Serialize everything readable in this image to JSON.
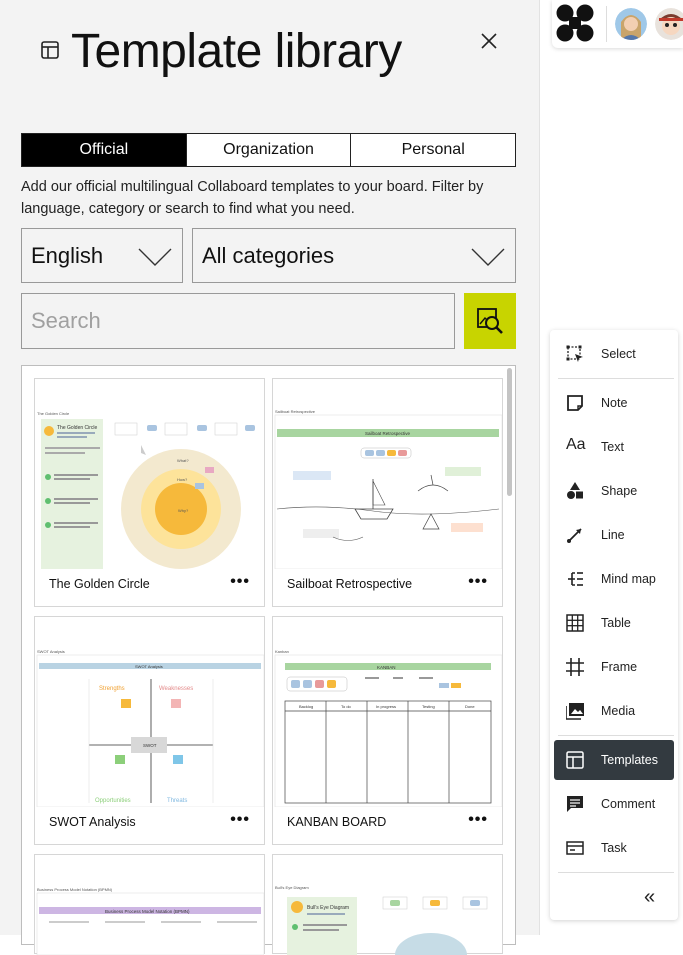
{
  "panel": {
    "title": "Template library",
    "tabs": [
      {
        "label": "Official",
        "active": true
      },
      {
        "label": "Organization",
        "active": false
      },
      {
        "label": "Personal",
        "active": false
      }
    ],
    "description": "Add our official multilingual Collaboard templates to your board. Filter by language, category or search to find what you need.",
    "language_select": "English",
    "category_select": "All categories",
    "search_placeholder": "Search",
    "search_button_color": "#c8d400"
  },
  "templates": [
    {
      "name": "The Golden Circle",
      "thumb": {
        "header": "The Golden Circle",
        "card_title": "The Golden Circle",
        "labels": [
          "What?",
          "How?",
          "Why?"
        ]
      }
    },
    {
      "name": "Sailboat Retrospective",
      "thumb": {
        "header": "Sailboat Retrospective",
        "banner": "Sailboat Retrospective"
      }
    },
    {
      "name": "SWOT Analysis",
      "thumb": {
        "header": "SWOT Analysis",
        "banner": "SWOT Analysis",
        "quadrants": [
          "Strengths",
          "Weaknesses",
          "Opportunities",
          "Threats"
        ],
        "center": "SWOT"
      }
    },
    {
      "name": "KANBAN BOARD",
      "thumb": {
        "header": "Kanban",
        "banner": "KANBAN",
        "columns": [
          "Backlog",
          "To do",
          "In progress",
          "Testing",
          "Done"
        ]
      }
    },
    {
      "name": "",
      "thumb": {
        "header": "Business Process Model Notation (BPMN)",
        "banner": "Business Process Model Notation (BPMN)"
      }
    },
    {
      "name": "",
      "thumb": {
        "header": "Bull's Eye Diagram",
        "card_title": "Bull's Eye Diagram"
      }
    }
  ],
  "more_label": "•••",
  "toolbar": {
    "items": [
      {
        "label": "Select",
        "icon": "select-icon"
      },
      {
        "label": "Note",
        "icon": "note-icon"
      },
      {
        "label": "Text",
        "icon": "text-icon",
        "glyph": "Aa"
      },
      {
        "label": "Shape",
        "icon": "shape-icon"
      },
      {
        "label": "Line",
        "icon": "line-icon"
      },
      {
        "label": "Mind map",
        "icon": "mind-map-icon"
      },
      {
        "label": "Table",
        "icon": "table-icon"
      },
      {
        "label": "Frame",
        "icon": "frame-icon"
      },
      {
        "label": "Media",
        "icon": "media-icon"
      },
      {
        "label": "Templates",
        "icon": "templates-icon",
        "active": true
      },
      {
        "label": "Comment",
        "icon": "comment-icon"
      },
      {
        "label": "Task",
        "icon": "task-icon"
      }
    ],
    "collapse_label": "«"
  }
}
